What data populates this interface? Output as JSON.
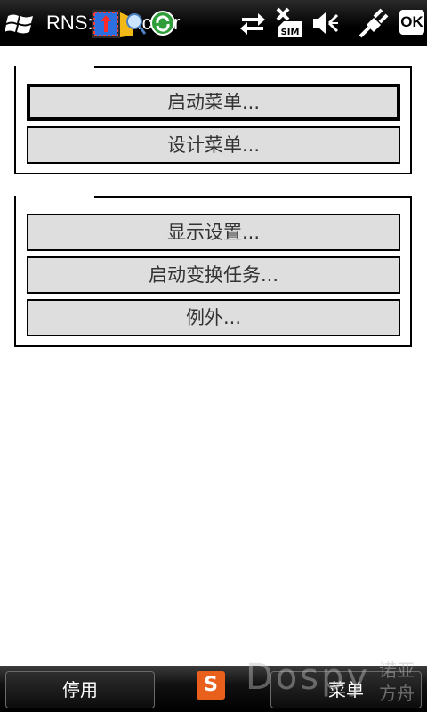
{
  "status_bar": {
    "app_title": "RNS: Launcher",
    "ok_label": "OK",
    "icons": [
      "windows-start-icon",
      "notification-icons",
      "sync-arrows-icon",
      "no-sim-icon",
      "volume-icon",
      "power-plug-icon"
    ]
  },
  "groups": [
    {
      "buttons": [
        {
          "label": "启动菜单...",
          "focused": true
        },
        {
          "label": "设计菜单..."
        }
      ]
    },
    {
      "buttons": [
        {
          "label": "显示设置..."
        },
        {
          "label": "启动变换任务..."
        },
        {
          "label": "例外..."
        }
      ]
    }
  ],
  "softkeys": {
    "left": "停用",
    "right": "菜单"
  },
  "ime": {
    "label": "S",
    "color": "#e8601c"
  },
  "watermark": {
    "logo": "Dospy",
    "line1": "诺亚",
    "line2": "方舟"
  }
}
